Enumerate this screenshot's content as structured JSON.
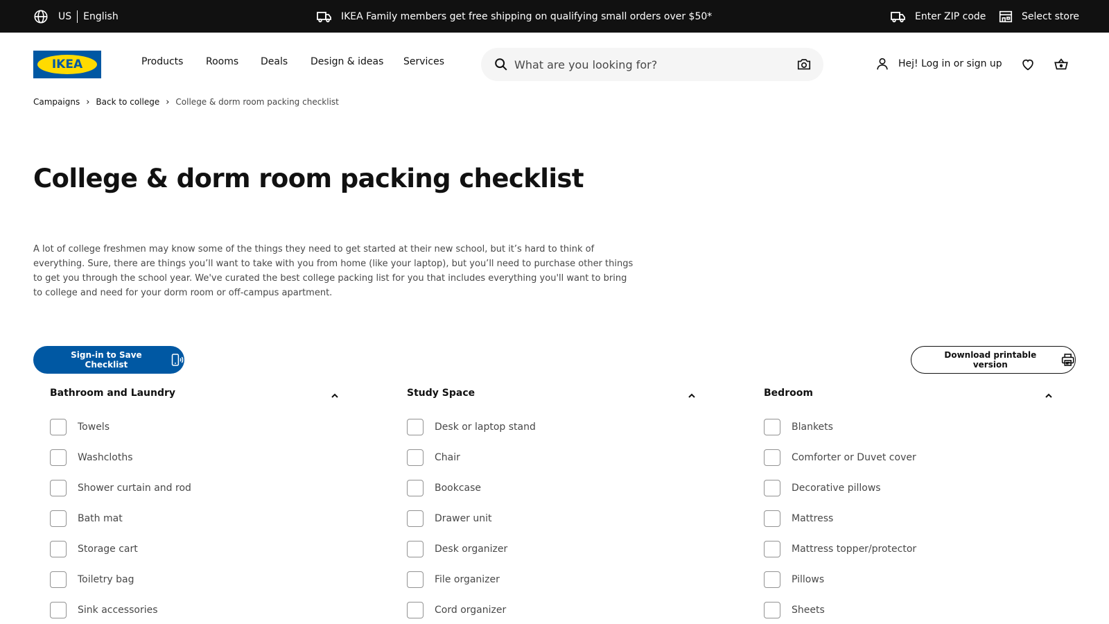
{
  "topbar": {
    "country": "US",
    "language": "English",
    "promo": "IKEA Family members get free shipping on qualifying small orders over $50*",
    "zip": "Enter ZIP code",
    "store": "Select store"
  },
  "header": {
    "logo_text": "IKEA",
    "nav": [
      "Products",
      "Rooms",
      "Deals",
      "Design & ideas",
      "Services"
    ],
    "search_placeholder": "What are you looking for?",
    "login": "Hej! Log in or sign up"
  },
  "breadcrumb": {
    "items": [
      "Campaigns",
      "Back to college",
      "College & dorm room packing checklist"
    ]
  },
  "page": {
    "title": "College & dorm room packing checklist",
    "intro": "A lot of college freshmen may know some of the things they need to get started at their new school, but it’s hard to think of everything. Sure, there are things you’ll want to take with you from home (like your laptop), but you’ll need to purchase other things to get you through the school year. We've curated the best college packing list for you that includes everything you'll want to bring to college and need for your dorm room or off-campus apartment.",
    "save_button": "Sign-in to Save Checklist",
    "download_button": "Download printable version"
  },
  "checklist": [
    {
      "title": "Bathroom and Laundry",
      "items": [
        "Towels",
        "Washcloths",
        "Shower curtain and rod",
        "Bath mat",
        "Storage cart",
        "Toiletry bag",
        "Sink accessories"
      ]
    },
    {
      "title": "Study Space",
      "items": [
        "Desk or laptop stand",
        "Chair",
        "Bookcase",
        "Drawer unit",
        "Desk organizer",
        "File organizer",
        "Cord organizer"
      ]
    },
    {
      "title": "Bedroom",
      "items": [
        "Blankets",
        "Comforter or Duvet cover",
        "Decorative pillows",
        "Mattress",
        "Mattress topper/protector",
        "Pillows",
        "Sheets"
      ]
    }
  ],
  "colors": {
    "ikea_blue": "#0058a3",
    "ikea_yellow": "#ffdb00",
    "topbar_bg": "#111111"
  }
}
